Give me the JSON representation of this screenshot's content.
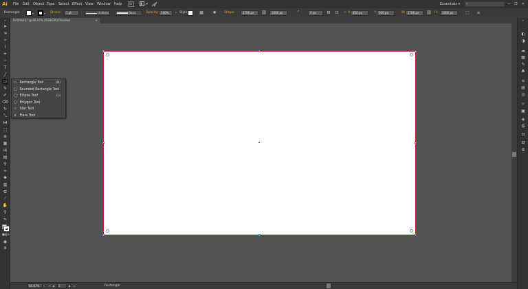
{
  "app": {
    "logo": "Ai"
  },
  "menu": [
    "File",
    "Edit",
    "Object",
    "Type",
    "Select",
    "Effect",
    "View",
    "Window",
    "Help"
  ],
  "menu_icons": {
    "bridge": "Br",
    "stock": "St",
    "arrange": "arrange-icon",
    "gpu": "gpu-icon"
  },
  "workspace": {
    "label": "Essentials",
    "arrow": "▾"
  },
  "search": {
    "placeholder": ""
  },
  "window_controls": {
    "minimize": "—",
    "restore": "❐",
    "close": "✕"
  },
  "control": {
    "selection": "Rectangle",
    "stroke_label": "Stroke:",
    "stroke_value": "1 pt",
    "profile": "Uniform",
    "brush": "Basic",
    "opacity_label": "Opacity:",
    "opacity_value": "100%",
    "style_label": "Style:",
    "shape_label": "Shape:",
    "shape_w": "2700 px",
    "shape_h": "1000 px",
    "corner": "0 px",
    "x_label": "X:",
    "x": "850 px",
    "y_label": "Y:",
    "y": "500 px",
    "w_label": "W:",
    "w": "1700 px",
    "h_label": "H:",
    "h": "1000 px",
    "fill_color": "#ffffff",
    "stroke_color": "#000000"
  },
  "document_tab": {
    "title": "Untitled-1* @ 66.67% (RGB/GPU Preview)",
    "close": "×"
  },
  "flyout": [
    {
      "icon": "▭",
      "label": "Rectangle Tool",
      "shortcut": "(M)",
      "name": "rectangle"
    },
    {
      "icon": "▢",
      "label": "Rounded Rectangle Tool",
      "shortcut": "",
      "name": "rounded-rectangle"
    },
    {
      "icon": "◯",
      "label": "Ellipse Tool",
      "shortcut": "(L)",
      "name": "ellipse"
    },
    {
      "icon": "⬡",
      "label": "Polygon Tool",
      "shortcut": "",
      "name": "polygon"
    },
    {
      "icon": "☆",
      "label": "Star Tool",
      "shortcut": "",
      "name": "star"
    },
    {
      "icon": "✶",
      "label": "Flare Tool",
      "shortcut": "",
      "name": "flare"
    }
  ],
  "status": {
    "zoom": "66.67%",
    "artboard": "1",
    "tool": "Rectangle"
  },
  "colors": {
    "accent": "#e8a23a",
    "artboard_border": "#b32424",
    "handle": "#4a6cd0"
  }
}
